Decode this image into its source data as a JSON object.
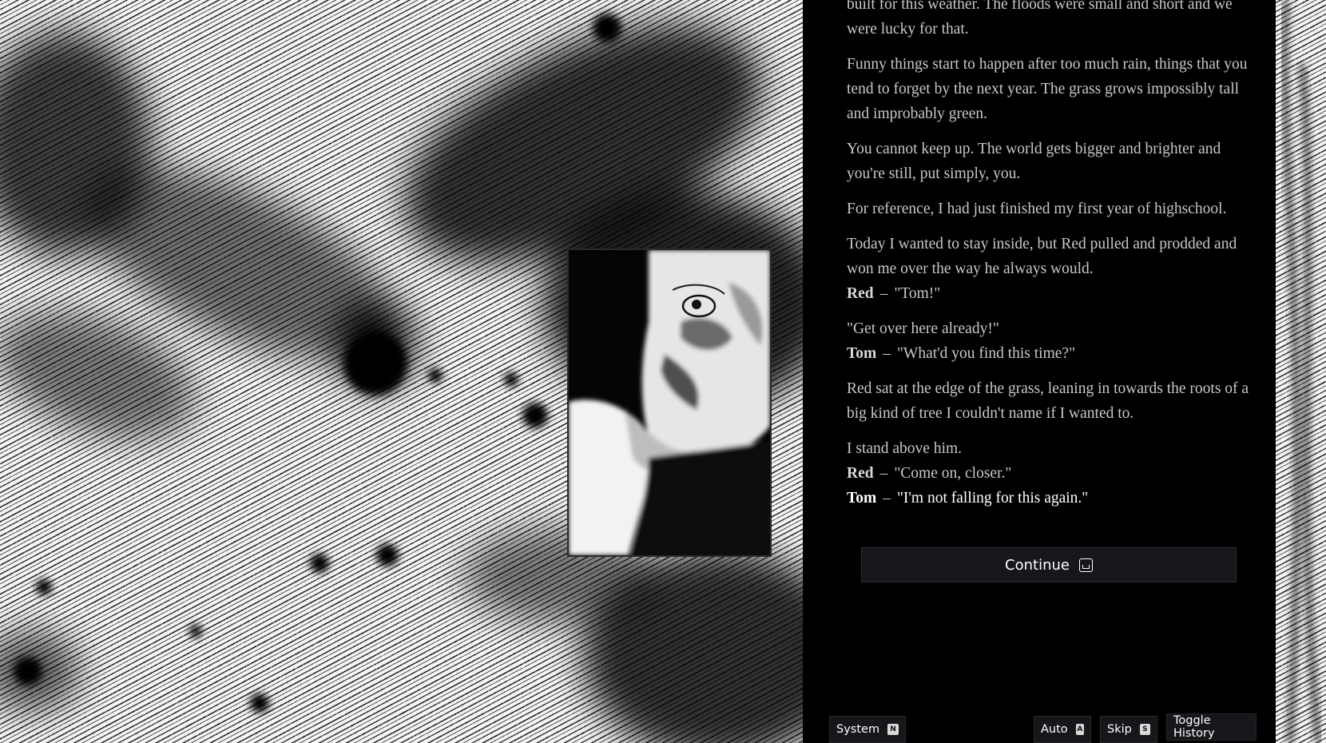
{
  "story": {
    "fragment_top": "built for this weather. The floods were small and short and we were lucky for that.",
    "paragraphs": [
      "Funny things start to happen after too much rain, things that you tend to forget by the next year. The grass grows impossibly tall and improbably green.",
      "You cannot keep up. The world gets bigger and brighter and you're still, put simply, you.",
      "For reference, I had just finished my first year of highschool.",
      "Today I wanted to stay inside, but Red pulled and prodded and won me over the way he always would."
    ],
    "dialogue_1": {
      "speaker": "Red",
      "dash": "–",
      "text": "\"Tom!\""
    },
    "line_get_over": "\"Get over here already!\"",
    "dialogue_2": {
      "speaker": "Tom",
      "dash": "–",
      "text": "\"What'd you find this time?\""
    },
    "paragraph_tree": "Red sat at the edge of the grass, leaning in towards the roots of a big kind of tree I couldn't name if I wanted to.",
    "line_stand": "I stand above him.",
    "dialogue_3": {
      "speaker": "Red",
      "dash": "–",
      "text": "\"Come on, closer.\""
    },
    "dialogue_4": {
      "speaker": "Tom",
      "dash": "–",
      "text": "\"I'm not falling for this again.\""
    }
  },
  "controls": {
    "continue_label": "Continue",
    "continue_icon": "spacebar-key-icon",
    "system_label": "System",
    "system_key": "N",
    "auto_label": "Auto",
    "auto_key": "A",
    "skip_label": "Skip",
    "skip_key": "S",
    "history_label": "Toggle History"
  },
  "colors": {
    "background": "#000000",
    "text": "#c8c8c8",
    "text_current": "#ffffff",
    "button_bg": "#16171a"
  }
}
